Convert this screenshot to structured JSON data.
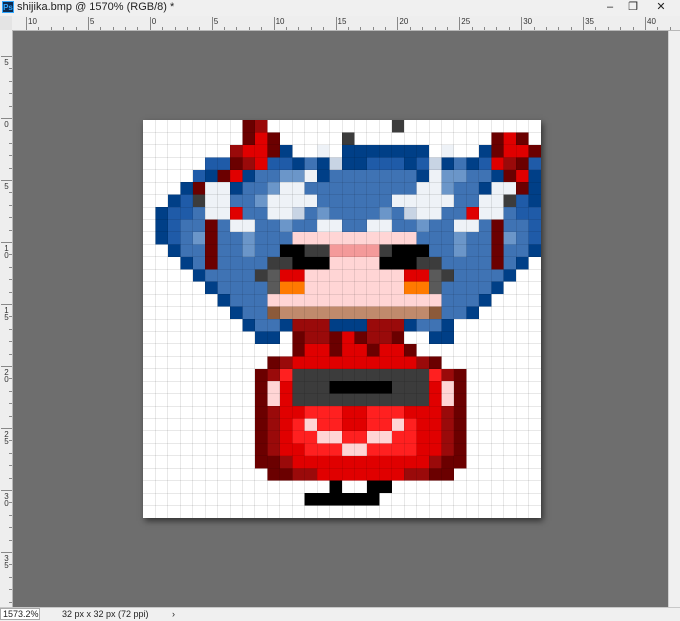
{
  "window": {
    "title": "shijika.bmp @ 1570% (RGB/8) *",
    "app_icon": "Ps",
    "controls": {
      "minimize": "–",
      "restore": "❐",
      "close": "✕"
    }
  },
  "rulers": {
    "horizontal_labels": [
      "10",
      "5",
      "0",
      "5",
      "10",
      "15",
      "20",
      "25",
      "30",
      "35",
      "40"
    ],
    "vertical_labels": [
      "5",
      "0",
      "5",
      "10",
      "15",
      "20",
      "25",
      "30",
      "35"
    ]
  },
  "status": {
    "zoom": "1573.2%",
    "doc_info": "32 px x 32 px (72 ppi)",
    "arrow": "›"
  },
  "canvas": {
    "background": "#ffffff",
    "workspace_color": "#6e6e6e",
    "palette": {
      ".": "#ffffff",
      "k": "#000000",
      "d": "#3c3c3c",
      "g": "#5a5a5a",
      "N": "#003f87",
      "B": "#1f5ba8",
      "b": "#3f73b4",
      "L": "#6b96c9",
      "S": "#c8d4e4",
      "W": "#eef2f7",
      "M": "#6b0000",
      "m": "#9a0a0a",
      "R": "#e00000",
      "r": "#ff2020",
      "P": "#ffd5d5",
      "p": "#f49a9a",
      "O": "#ff7a00",
      "T": "#c08a6c",
      "t": "#8c5a3a"
    },
    "rows": [
      "........Mm..........d..........",
      "........MRM.....d...........MRM.",
      ".......mRRMN..W.NNNNNNN.W..NMRRM",
      ".....BBMmRBBNbNSNNBBBNBSNbNBRmMBB",
      "....BNMRNbbLLWNbbbbbbbNWLLbbNMRNB",
      "...NMWWNbbLWWbbbbbbbbbWWLbbNWWMN",
      "..NBdWWbbLWWWWbbbbbbWWWWWbbWWdBN",
      ".NBBbWWRbbWWSbLbbbbLbSWWbbRWWbBBN",
      ".NBbbMbWWbbLbbWWbbWWbbLbbWWbMbbBN",
      ".NBbLMbbLbbbPPPPPPPPPPbbbLbbMLbBN",
      "..NbbMbbLbbkkddppppdkkkbbLbbMbbN.",
      "...NbMbbbbddkkkPPPPkkkddbbbbMbN..",
      "....NbbbbdgRRPPPPPPPPRRgdbbbbN...",
      ".....NbbbbgOOPPPPPPPPOOgbbbbN....",
      "......NbbbPPPPPPPPPPPPPPbbbN.....",
      ".......NbbtTTTTTTTTTTTTtbbN......",
      "........NbbNmmmNNNmmmNbbN.......",
      ".........NN.MmmMRMmmM..NN.......",
      "............MRRMRRMRRM..........",
      "..........MmRRRRRRRRRRmM........",
      ".........MmrdddddddddddrmM......",
      ".........MPRdddkkkkkdddRPM......",
      ".........MPRdddddddddddRPM......",
      ".........MmRRrrrRRrrrRRRmM......",
      ".........MmRrPrrRRrrPrRRmM......",
      ".........MmRrrPPrrPPrrRRmM......",
      ".........MmRRrrrPPrrrrRRmM......",
      ".........MMmRRRRRRRRRRRmMM......",
      "..........MMmmRRRRRRRmmMM.......",
      "...............k..kk............",
      ".............kkkkkk.............",
      "..............................."
    ]
  }
}
